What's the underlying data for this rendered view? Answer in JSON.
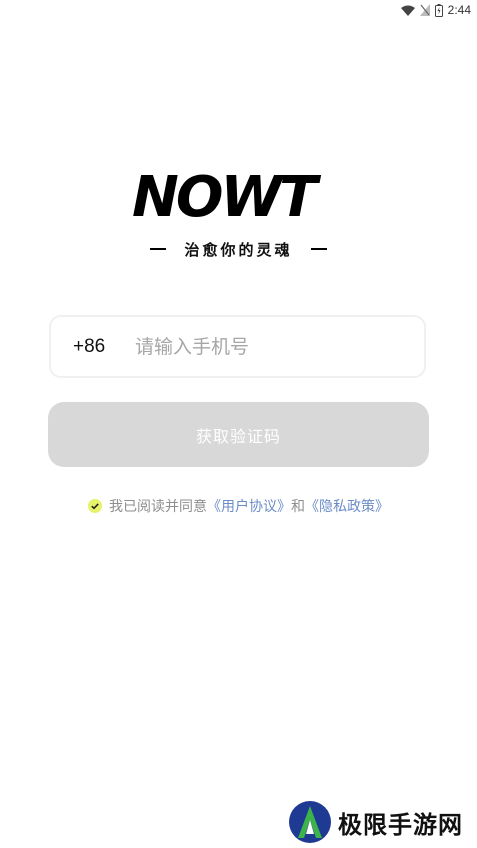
{
  "status_bar": {
    "time": "2:44"
  },
  "brand": {
    "logo_text": "NOWT",
    "tagline": "治愈你的灵魂"
  },
  "login": {
    "country_code": "+86",
    "phone_placeholder": "请输入手机号",
    "get_code_label": "获取验证码"
  },
  "agreement": {
    "prefix": "我已阅读并同意",
    "user_agreement": "《用户协议》",
    "conjunction": "和",
    "privacy_policy": "《隐私政策》"
  },
  "watermark": {
    "text": "极限手游网"
  },
  "colors": {
    "button_disabled": "#d8d8d8",
    "link": "#6c8cc8",
    "check_accent": "#e6f36a"
  }
}
